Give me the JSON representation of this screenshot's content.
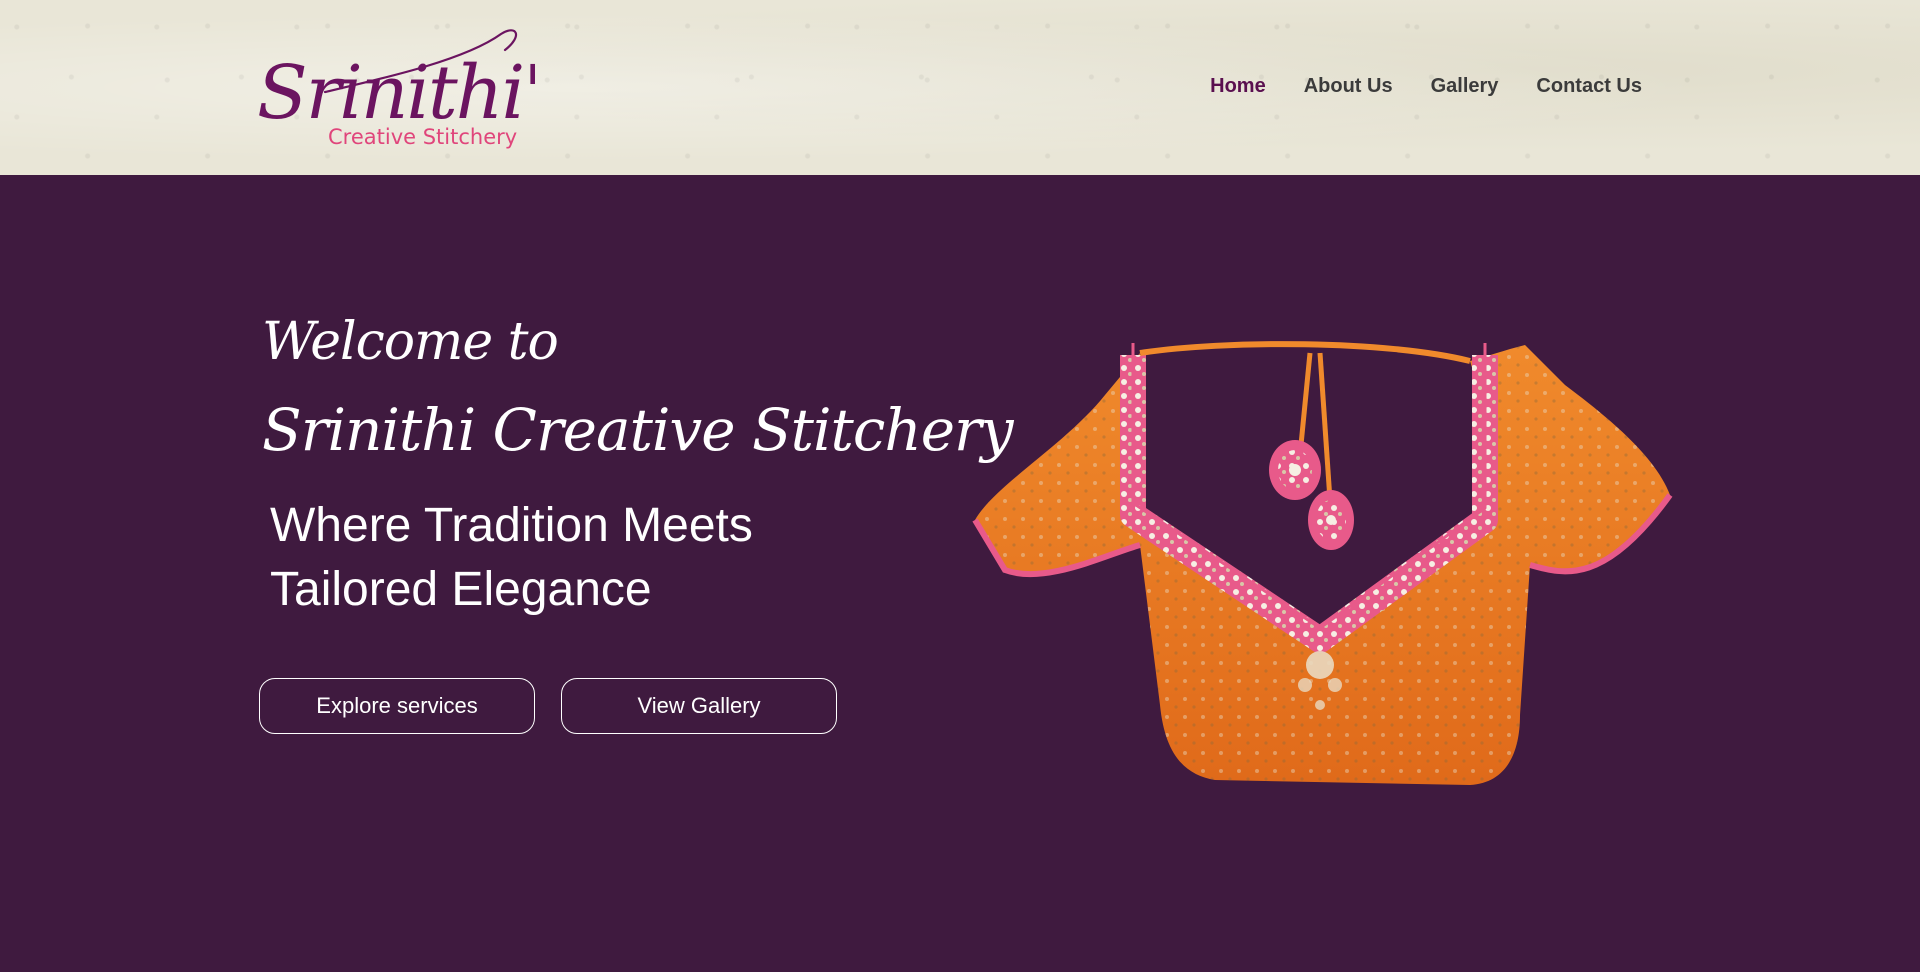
{
  "brand": {
    "logo_main": "Srinithi's",
    "logo_sub": "Creative Stitchery"
  },
  "nav": {
    "items": [
      {
        "label": "Home",
        "active": true
      },
      {
        "label": "About Us",
        "active": false
      },
      {
        "label": "Gallery",
        "active": false
      },
      {
        "label": "Contact Us",
        "active": false
      }
    ]
  },
  "hero": {
    "welcome": "Welcome to",
    "brand_name": "Srinithi Creative Stitchery",
    "tagline_line1": "Where Tradition Meets",
    "tagline_line2": "Tailored Elegance",
    "buttons": {
      "explore": "Explore services",
      "gallery": "View Gallery"
    },
    "image": "embroidered-blouse-image"
  },
  "colors": {
    "hero_bg": "#3f1a3f",
    "header_bg": "#e9e6d7",
    "brand_purple": "#6b1460",
    "brand_pink": "#e0457b",
    "nav_active": "#5a0f4f",
    "nav_text": "#3b3b3b",
    "blouse_orange": "#ee7a25"
  }
}
